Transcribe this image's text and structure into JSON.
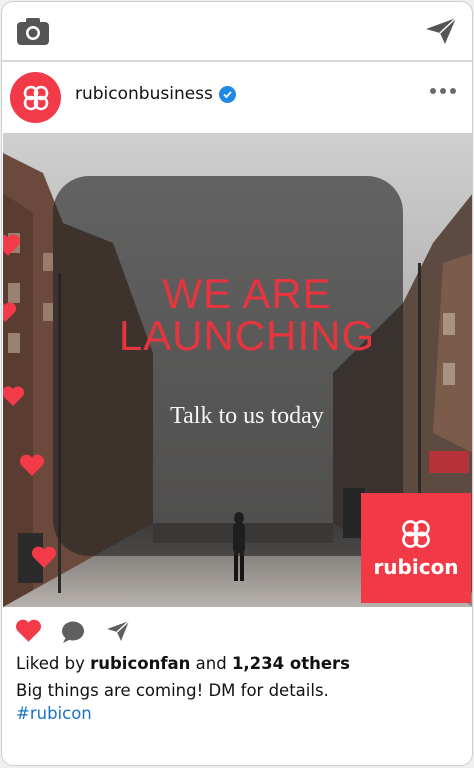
{
  "header": {
    "camera_icon": "camera-icon",
    "send_icon": "paper-plane-icon"
  },
  "profile": {
    "username": "rubiconbusiness",
    "verified": true,
    "avatar_color": "#f23a48"
  },
  "post": {
    "headline_line1": "WE ARE",
    "headline_line2": "LAUNCHING",
    "subtitle": "Talk to us today",
    "brand_name": "rubicon",
    "accent_color": "#f13a45"
  },
  "engagement": {
    "liked_prefix": "Liked by ",
    "liked_user": "rubiconfan",
    "liked_and": " and ",
    "liked_count": "1,234 others",
    "caption": "Big things are coming! DM for details.",
    "hashtag": "#rubicon"
  }
}
